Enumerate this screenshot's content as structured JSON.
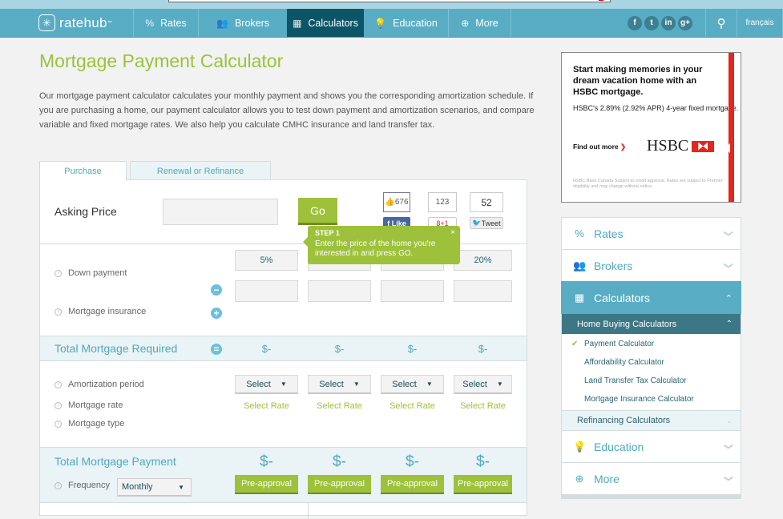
{
  "nav": {
    "logo": "ratehub",
    "items": [
      {
        "label": "Rates",
        "icon": "percent-icon"
      },
      {
        "label": "Brokers",
        "icon": "people-icon"
      },
      {
        "label": "Calculators",
        "icon": "calculator-icon",
        "active": true
      },
      {
        "label": "Education",
        "icon": "lightbulb-icon"
      },
      {
        "label": "More",
        "icon": "plus-circle-icon"
      }
    ],
    "social": [
      "f",
      "t",
      "in",
      "g+"
    ],
    "language": "français"
  },
  "page": {
    "title": "Mortgage Payment Calculator",
    "intro": "Our mortgage payment calculator calculates your monthly payment and shows you the corresponding amortization schedule. If you are purchasing a home, our payment calculator allows you to test down payment and amortization scenarios, and compare variable and fixed mortgage rates. We also help you calculate CMHC insurance and land transfer tax."
  },
  "tabs": {
    "purchase": "Purchase",
    "renewal": "Renewal or Refinance"
  },
  "calculator": {
    "asking_price_label": "Asking Price",
    "asking_price_value": "",
    "go_label": "Go",
    "share": {
      "facebook_count": "676",
      "facebook_label": "Like",
      "google_count": "123",
      "google_label": "+1",
      "twitter_count": "52",
      "twitter_label": "Tweet"
    },
    "tooltip": {
      "title": "STEP 1",
      "body": "Enter the price of the home you're interested in and press GO.",
      "close": "×"
    },
    "down_payment_label": "Down payment",
    "down_payment_pcts": [
      "5%",
      "",
      "",
      "20%"
    ],
    "mortgage_insurance_label": "Mortgage insurance",
    "total_required_label": "Total Mortgage Required",
    "total_required_values": [
      "$-",
      "$-",
      "$-",
      "$-"
    ],
    "amortization_label": "Amortization period",
    "amortization_selects": [
      "Select",
      "Select",
      "Select",
      "Select"
    ],
    "rate_label": "Mortgage rate",
    "rate_links": [
      "Select Rate",
      "Select Rate",
      "Select Rate",
      "Select Rate"
    ],
    "type_label": "Mortgage type",
    "total_payment_label": "Total Mortgage Payment",
    "total_payment_values": [
      "$-",
      "$-",
      "$-",
      "$-"
    ],
    "frequency_label": "Frequency",
    "frequency_value": "Monthly",
    "preapproval_label": "Pre-approval"
  },
  "ad": {
    "headline": "Start making memories in your dream vacation home with an HSBC mortgage.",
    "sub": "HSBC's 2.89% (2.92% APR) 4-year fixed mortgage.",
    "cta": "Find out more",
    "brand": "HSBC",
    "fine_print": "HSBC Bank Canada Subject to credit approval. Rates are subject to Premier eligibility and may change without notice."
  },
  "sidebar": {
    "items": [
      {
        "label": "Rates"
      },
      {
        "label": "Brokers"
      },
      {
        "label": "Calculators"
      },
      {
        "label": "Education"
      },
      {
        "label": "More"
      }
    ],
    "home_buying_label": "Home Buying Calculators",
    "home_buying_links": [
      "Payment Calculator",
      "Affordability Calculator",
      "Land Transfer Tax Calculator",
      "Mortgage Insurance Calculator"
    ],
    "refinancing_label": "Refinancing Calculators"
  },
  "colors": {
    "brand_green": "#9dc13b",
    "brand_blue": "#58adc4",
    "active_nav": "#0c5567",
    "hsbc_red": "#e4261c"
  }
}
